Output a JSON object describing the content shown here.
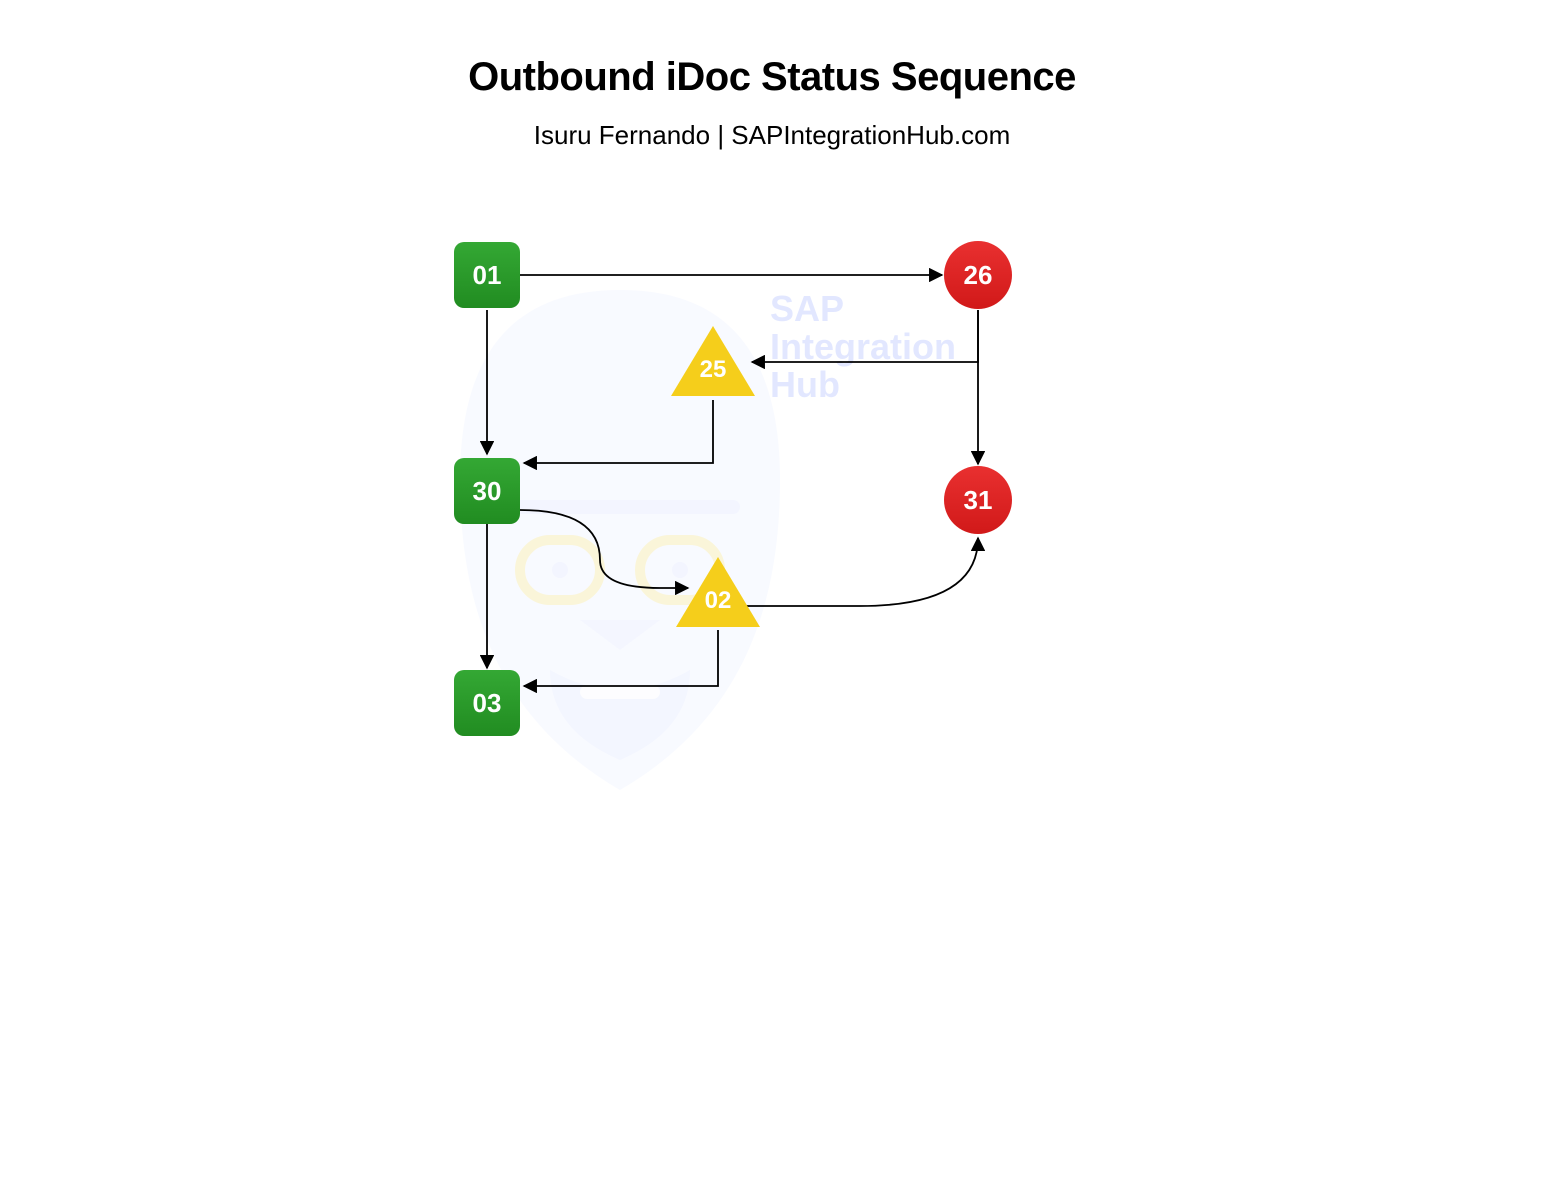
{
  "header": {
    "title": "Outbound iDoc Status Sequence",
    "subtitle": "Isuru Fernando  |  SAPIntegrationHub.com"
  },
  "watermark": {
    "line1": "SAP",
    "line2": "Integration",
    "line3": "Hub"
  },
  "nodes": {
    "n01": {
      "label": "01",
      "type": "success"
    },
    "n30": {
      "label": "30",
      "type": "success"
    },
    "n03": {
      "label": "03",
      "type": "success"
    },
    "n26": {
      "label": "26",
      "type": "error"
    },
    "n31": {
      "label": "31",
      "type": "error"
    },
    "n25": {
      "label": "25",
      "type": "warning"
    },
    "n02": {
      "label": "02",
      "type": "warning"
    }
  },
  "edges": [
    {
      "from": "01",
      "to": "26"
    },
    {
      "from": "01",
      "to": "30"
    },
    {
      "from": "26",
      "to": "25"
    },
    {
      "from": "26",
      "to": "31"
    },
    {
      "from": "25",
      "to": "30"
    },
    {
      "from": "30",
      "to": "02"
    },
    {
      "from": "30",
      "to": "03"
    },
    {
      "from": "02",
      "to": "31"
    },
    {
      "from": "02",
      "to": "03"
    }
  ],
  "colors": {
    "success": "#2d9c2d",
    "error": "#e22525",
    "warning": "#f5ce1b",
    "arrow": "#000000"
  }
}
